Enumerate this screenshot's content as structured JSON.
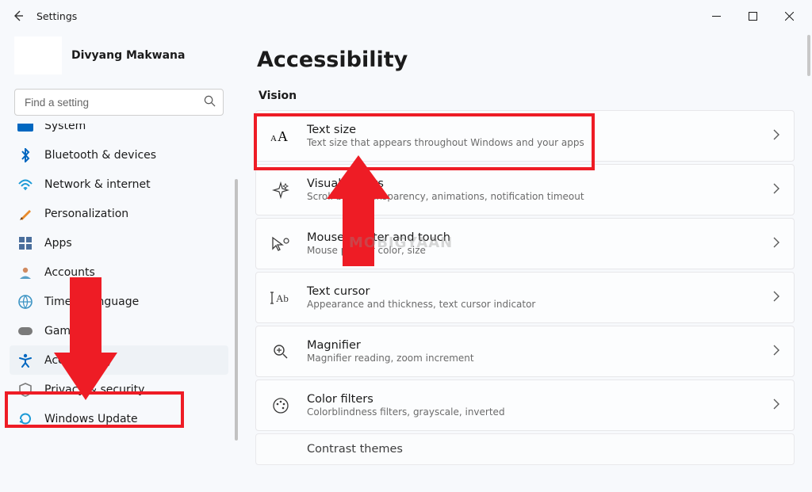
{
  "titlebar": {
    "title": "Settings"
  },
  "user": {
    "name": "Divyang Makwana"
  },
  "search": {
    "placeholder": "Find a setting"
  },
  "nav": {
    "items": [
      {
        "key": "system",
        "label": "System"
      },
      {
        "key": "bluetooth",
        "label": "Bluetooth & devices"
      },
      {
        "key": "network",
        "label": "Network & internet"
      },
      {
        "key": "personalization",
        "label": "Personalization"
      },
      {
        "key": "apps",
        "label": "Apps"
      },
      {
        "key": "accounts",
        "label": "Accounts"
      },
      {
        "key": "time",
        "label": "Time & language"
      },
      {
        "key": "gaming",
        "label": "Gaming"
      },
      {
        "key": "accessibility",
        "label": "Accessibility"
      },
      {
        "key": "privacy",
        "label": "Privacy & security"
      },
      {
        "key": "update",
        "label": "Windows Update"
      }
    ]
  },
  "page": {
    "title": "Accessibility",
    "section": "Vision",
    "items": [
      {
        "title": "Text size",
        "desc": "Text size that appears throughout Windows and your apps"
      },
      {
        "title": "Visual effects",
        "desc": "Scroll bars, transparency, animations, notification timeout"
      },
      {
        "title": "Mouse pointer and touch",
        "desc": "Mouse pointer color, size"
      },
      {
        "title": "Text cursor",
        "desc": "Appearance and thickness, text cursor indicator"
      },
      {
        "title": "Magnifier",
        "desc": "Magnifier reading, zoom increment"
      },
      {
        "title": "Color filters",
        "desc": "Colorblindness filters, grayscale, inverted"
      },
      {
        "title": "Contrast themes",
        "desc": ""
      }
    ]
  },
  "watermark": "MOBIGYAAN",
  "colors": {
    "accent": "#0067c0",
    "highlight": "#ee1c25"
  }
}
